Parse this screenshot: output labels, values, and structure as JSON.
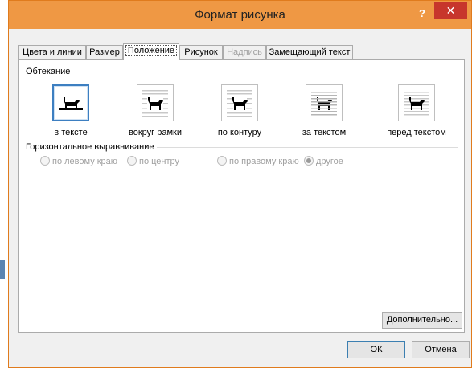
{
  "dialog": {
    "title": "Формат рисунка",
    "help_label": "?",
    "close_label": "✕"
  },
  "tabs": [
    {
      "label": "Цвета и линии",
      "state": "normal"
    },
    {
      "label": "Размер",
      "state": "normal"
    },
    {
      "label": "Положение",
      "state": "active"
    },
    {
      "label": "Рисунок",
      "state": "normal"
    },
    {
      "label": "Надпись",
      "state": "disabled"
    },
    {
      "label": "Замещающий текст",
      "state": "normal"
    }
  ],
  "wrapping": {
    "group_label": "Обтекание",
    "options": [
      {
        "label": "в тексте",
        "icon": "inline-with-text-icon",
        "selected": true
      },
      {
        "label": "вокруг рамки",
        "icon": "square-wrap-icon",
        "selected": false
      },
      {
        "label": "по контуру",
        "icon": "tight-wrap-icon",
        "selected": false
      },
      {
        "label": "за текстом",
        "icon": "behind-text-icon",
        "selected": false
      },
      {
        "label": "перед текстом",
        "icon": "in-front-of-text-icon",
        "selected": false
      }
    ]
  },
  "horizontal_alignment": {
    "group_label": "Горизонтальное выравнивание",
    "options": [
      {
        "label": "по левому краю",
        "checked": false
      },
      {
        "label": "по центру",
        "checked": false
      },
      {
        "label": "по правому краю",
        "checked": false
      },
      {
        "label": "другое",
        "checked": true
      }
    ]
  },
  "buttons": {
    "advanced": "Дополнительно...",
    "ok": "ОК",
    "cancel": "Отмена"
  },
  "colors": {
    "titlebar": "#ef9844",
    "close": "#c7362c",
    "selection": "#3d7fc1"
  }
}
